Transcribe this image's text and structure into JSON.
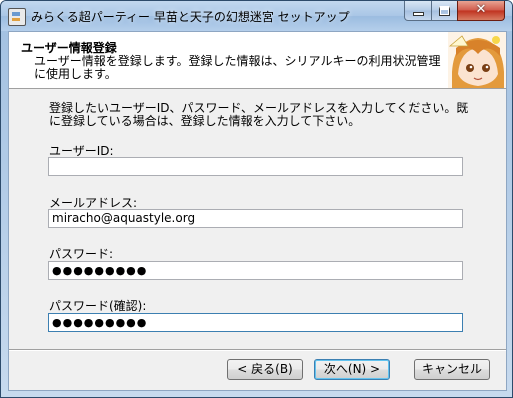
{
  "window": {
    "title": "みらくる超パーティー 早苗と天子の幻想迷宮 セットアップ",
    "close_glyph": "✕"
  },
  "header": {
    "title": "ユーザー情報登録",
    "description": "ユーザー情報を登録します。登録した情報は、シリアルキーの利用状況管理に使用します。"
  },
  "instructions": "登録したいユーザーID、パスワード、メールアドレスを入力してください。既に登録している場合は、登録した情報を入力して下さい。",
  "form": {
    "user_id": {
      "label": "ユーザーID:",
      "value": ""
    },
    "email": {
      "label": "メールアドレス:",
      "value": "miracho@aquastyle.org"
    },
    "password": {
      "label": "パスワード:",
      "value": "●●●●●●●●●"
    },
    "password_confirm": {
      "label": "パスワード(確認):",
      "value": "●●●●●●●●●"
    }
  },
  "buttons": {
    "back": "< 戻る(B)",
    "next": "次へ(N) >",
    "cancel": "キャンセル"
  }
}
